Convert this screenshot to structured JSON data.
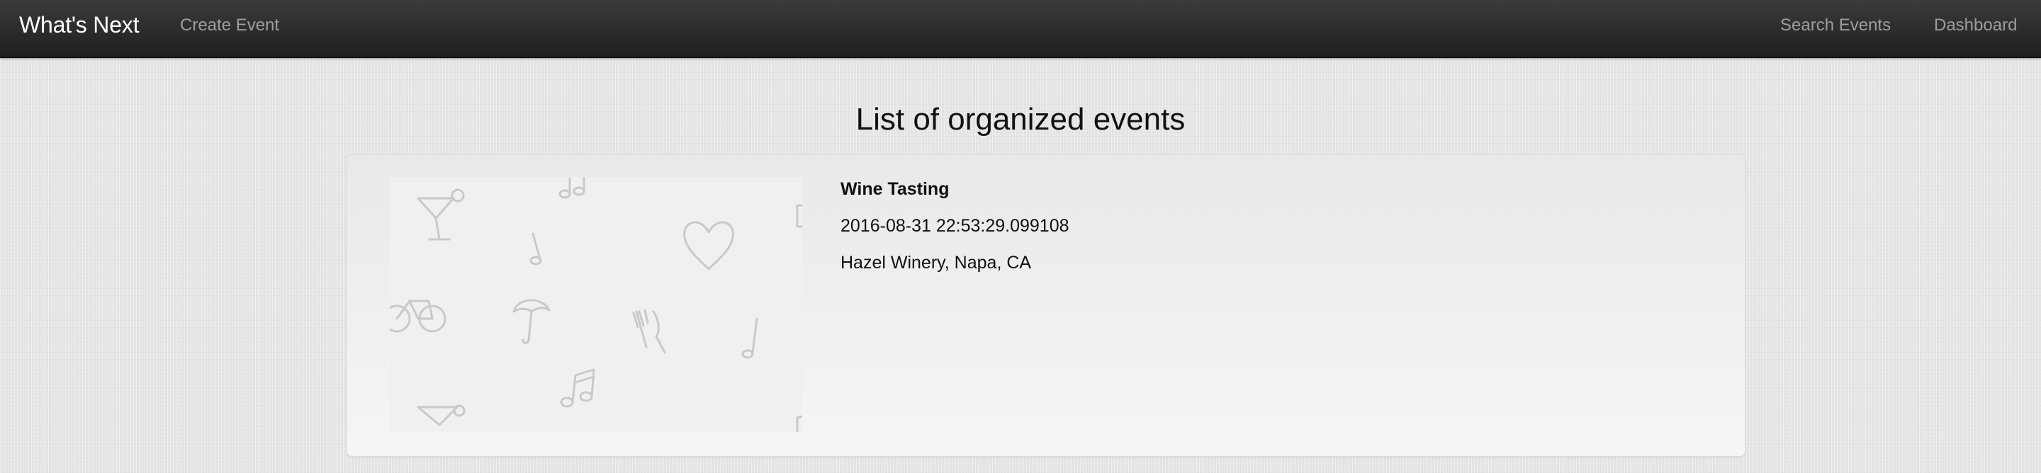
{
  "navbar": {
    "brand": "What's Next",
    "links": {
      "create_event": "Create Event",
      "search_events": "Search Events",
      "dashboard": "Dashboard"
    }
  },
  "main": {
    "title": "List of organized events",
    "events": [
      {
        "name": "Wine Tasting",
        "datetime": "2016-08-31 22:53:29.099108",
        "location": "Hazel Winery, Napa, CA",
        "image_icons": [
          "cocktail-icon",
          "music-note-icon",
          "heart-icon",
          "bicycle-icon",
          "umbrella-icon",
          "fork-knife-icon"
        ]
      }
    ]
  },
  "colors": {
    "navbar_bg": "#2b2b2b",
    "brand_text": "#ffffff",
    "nav_link_text": "#9d9d9d",
    "page_bg": "#e4e5e7",
    "card_bg": "#efefef"
  }
}
